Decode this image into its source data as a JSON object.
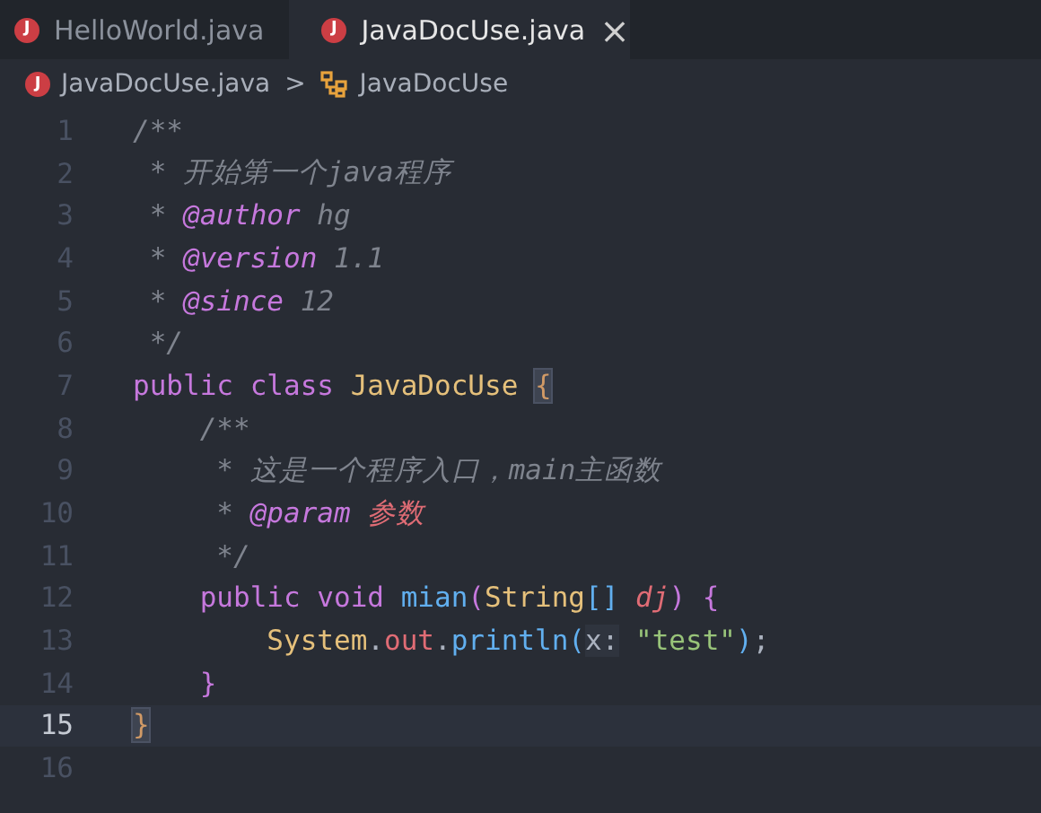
{
  "tabs": [
    {
      "icon_letter": "J",
      "label": "HelloWorld.java",
      "selected": false
    },
    {
      "icon_letter": "J",
      "label": "JavaDocUse.java",
      "selected": true,
      "close": "×"
    }
  ],
  "breadcrumb": {
    "file_icon_letter": "J",
    "file": "JavaDocUse.java",
    "separator": ">",
    "symbol": "JavaDocUse"
  },
  "lines": [
    {
      "number": "1",
      "current": false,
      "tokens": [
        {
          "text": "/**",
          "kind": "comment"
        }
      ]
    },
    {
      "number": "2",
      "current": false,
      "tokens": [
        {
          "text": " * 开始第一个java程序",
          "kind": "comment"
        }
      ]
    },
    {
      "number": "3",
      "current": false,
      "tokens": [
        {
          "text": " * ",
          "kind": "comment"
        },
        {
          "text": "@author",
          "kind": "tag"
        },
        {
          "text": " hg",
          "kind": "comment"
        }
      ]
    },
    {
      "number": "4",
      "current": false,
      "tokens": [
        {
          "text": " * ",
          "kind": "comment"
        },
        {
          "text": "@version",
          "kind": "tag"
        },
        {
          "text": " 1.1",
          "kind": "comment"
        }
      ]
    },
    {
      "number": "5",
      "current": false,
      "tokens": [
        {
          "text": " * ",
          "kind": "comment"
        },
        {
          "text": "@since",
          "kind": "tag"
        },
        {
          "text": " 12",
          "kind": "comment"
        }
      ]
    },
    {
      "number": "6",
      "current": false,
      "tokens": [
        {
          "text": " */",
          "kind": "comment"
        }
      ]
    },
    {
      "number": "7",
      "current": false,
      "tokens": [
        {
          "text": "public",
          "kind": "keyword"
        },
        {
          "text": " class",
          "kind": "keyword"
        },
        {
          "text": " JavaDocUse ",
          "kind": "type"
        },
        {
          "text": "{",
          "kind": "match"
        }
      ]
    },
    {
      "number": "8",
      "current": false,
      "tokens": [
        {
          "text": "    /**",
          "kind": "comment"
        }
      ]
    },
    {
      "number": "9",
      "current": false,
      "tokens": [
        {
          "text": "     * 这是一个程序入口，main主函数",
          "kind": "comment"
        }
      ]
    },
    {
      "number": "10",
      "current": false,
      "tokens": [
        {
          "text": "     * ",
          "kind": "comment"
        },
        {
          "text": "@param",
          "kind": "tag"
        },
        {
          "text": " 参数",
          "kind": "param"
        }
      ]
    },
    {
      "number": "11",
      "current": false,
      "tokens": [
        {
          "text": "     */",
          "kind": "comment"
        }
      ]
    },
    {
      "number": "12",
      "current": false,
      "tokens": [
        {
          "text": "    public",
          "kind": "keyword"
        },
        {
          "text": " void",
          "kind": "keyword"
        },
        {
          "text": " mian",
          "kind": "func"
        },
        {
          "text": "(",
          "kind": "bracket2"
        },
        {
          "text": "String",
          "kind": "type"
        },
        {
          "text": "[]",
          "kind": "bracket3"
        },
        {
          "text": " dj",
          "kind": "param"
        },
        {
          "text": ")",
          "kind": "bracket2"
        },
        {
          "text": " {",
          "kind": "bracket2"
        }
      ]
    },
    {
      "number": "13",
      "current": false,
      "tokens": [
        {
          "text": "        System",
          "kind": "type"
        },
        {
          "text": ".",
          "kind": "plain"
        },
        {
          "text": "out",
          "kind": "field"
        },
        {
          "text": ".",
          "kind": "plain"
        },
        {
          "text": "println",
          "kind": "func"
        },
        {
          "text": "(",
          "kind": "bracket3"
        },
        {
          "text": "x:",
          "kind": "hint"
        },
        {
          "text": " \"test\"",
          "kind": "string"
        },
        {
          "text": ")",
          "kind": "bracket3"
        },
        {
          "text": ";",
          "kind": "plain"
        }
      ]
    },
    {
      "number": "14",
      "current": false,
      "tokens": [
        {
          "text": "    }",
          "kind": "bracket2"
        }
      ]
    },
    {
      "number": "15",
      "current": true,
      "tokens": [
        {
          "text": "}",
          "kind": "match"
        }
      ]
    },
    {
      "number": "16",
      "current": false
    }
  ]
}
